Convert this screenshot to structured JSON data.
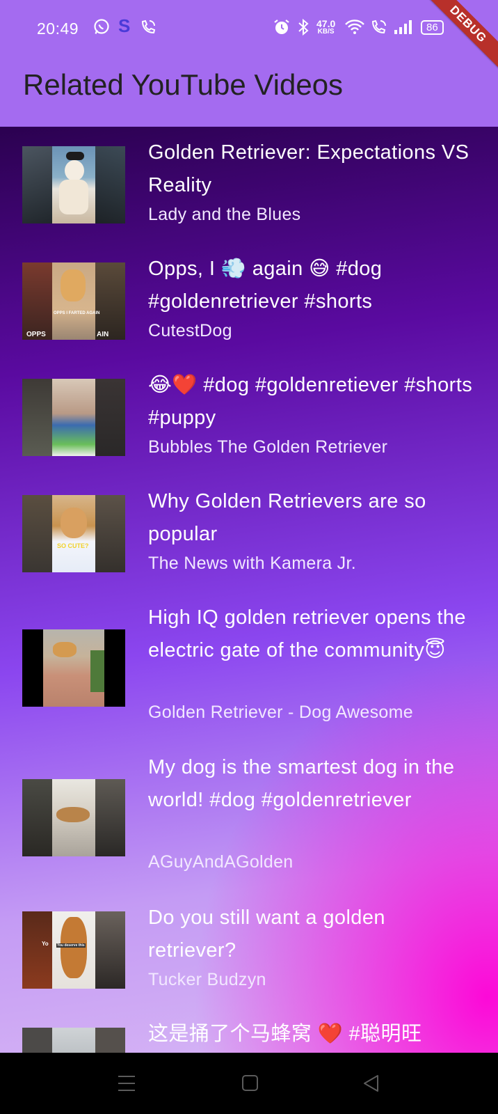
{
  "status_bar": {
    "time": "20:49",
    "net_speed_value": "47.0",
    "net_speed_unit": "KB/S",
    "battery": "86"
  },
  "debug_banner": "DEBUG",
  "app_bar": {
    "title": "Related YouTube Videos"
  },
  "videos": [
    {
      "title": "Golden Retriever: Expectations VS Reality",
      "channel": "Lady and the Blues"
    },
    {
      "title": "Opps, I 💨 again 😅 #dog #goldenretriever #shorts",
      "channel": "CutestDog"
    },
    {
      "title": "😂❤️ #dog #goldenretiever #shorts #puppy",
      "channel": "Bubbles The Golden Retriever"
    },
    {
      "title": "Why Golden Retrievers are so popular",
      "channel": "The News with Kamera Jr."
    },
    {
      "title": "High IQ golden retriever opens the electric gate of the community😇",
      "channel": "Golden Retriever - Dog Awesome"
    },
    {
      "title": "My dog is the smartest dog in the world! #dog #goldenretriever",
      "channel": "AGuyAndAGolden"
    },
    {
      "title": "Do you still want a golden retriever?",
      "channel": "Tucker Budzyn"
    },
    {
      "title": "这是捅了个马蜂窝 ❤️ #聪明旺",
      "channel": ""
    }
  ],
  "thumb_captions": {
    "v2_overlay": "OPPS I FARTED AGAIN",
    "v2_left": "OPPS",
    "v2_right": "AIN",
    "v4": "SO CUTE?",
    "v7_left": "Yo",
    "v7_center": "You deserve this"
  },
  "icons": [
    "whatsapp-icon",
    "s-app-icon",
    "phone-wifi-icon",
    "alarm-icon",
    "bluetooth-icon",
    "wifi-icon",
    "call-icon",
    "signal-icon",
    "battery-icon",
    "menu-icon",
    "home-icon",
    "back-icon"
  ]
}
